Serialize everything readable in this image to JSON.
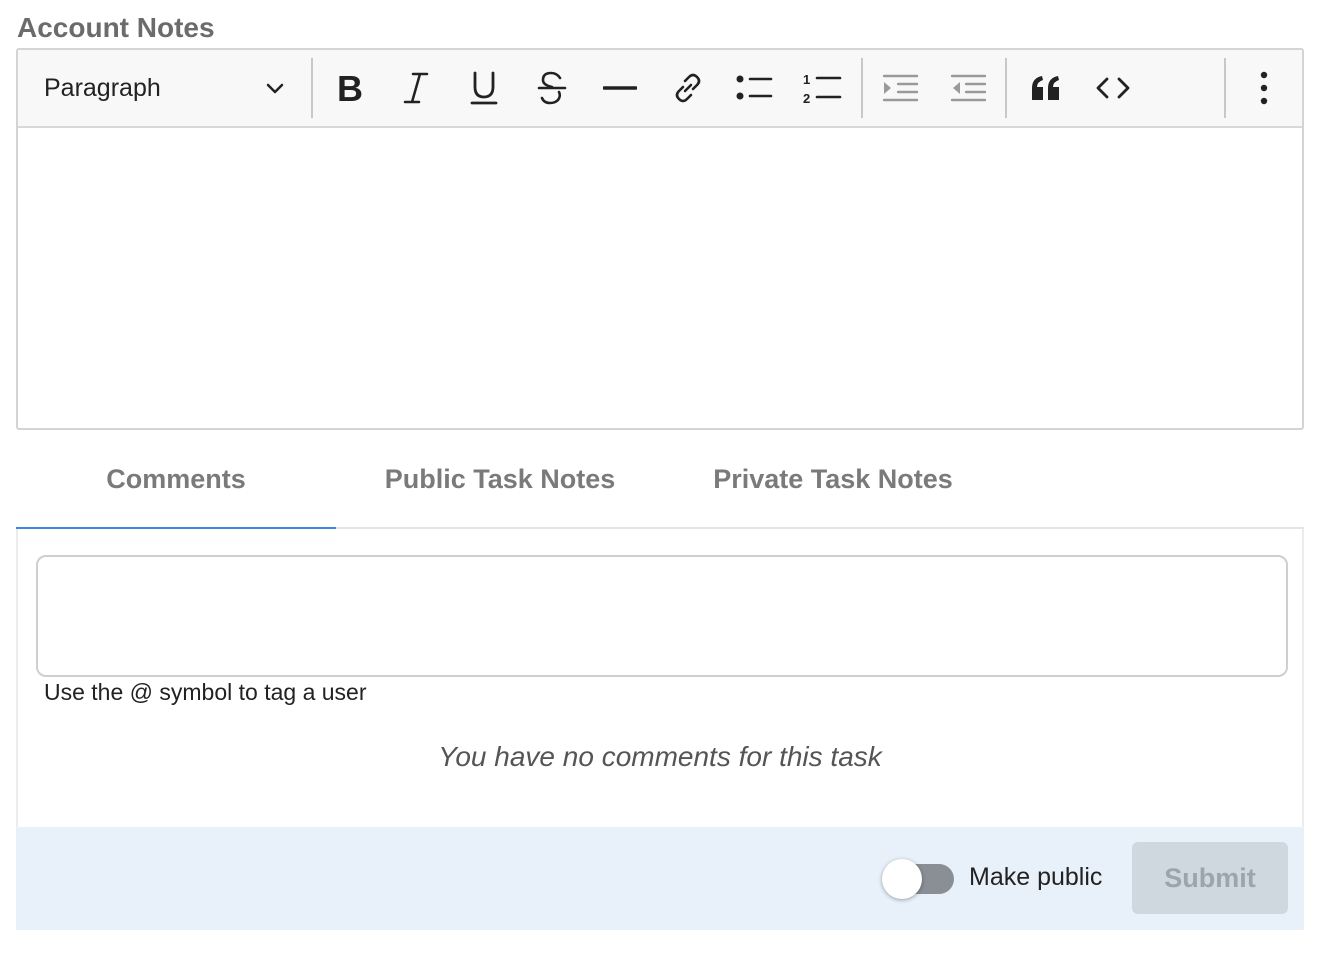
{
  "section": {
    "title": "Account Notes"
  },
  "toolbar": {
    "block_format": "Paragraph",
    "buttons": [
      {
        "id": "bold",
        "icon": "bold-icon"
      },
      {
        "id": "italic",
        "icon": "italic-icon"
      },
      {
        "id": "underline",
        "icon": "underline-icon"
      },
      {
        "id": "strikethrough",
        "icon": "strikethrough-icon"
      },
      {
        "id": "horizontal-rule",
        "icon": "horizontal-rule-icon"
      },
      {
        "id": "link",
        "icon": "link-icon"
      },
      {
        "id": "bulleted-list",
        "icon": "bulleted-list-icon"
      },
      {
        "id": "numbered-list",
        "icon": "numbered-list-icon"
      },
      {
        "id": "indent",
        "icon": "indent-icon"
      },
      {
        "id": "outdent",
        "icon": "outdent-icon"
      },
      {
        "id": "blockquote",
        "icon": "quote-icon"
      },
      {
        "id": "code",
        "icon": "code-icon"
      },
      {
        "id": "more",
        "icon": "more-vertical-icon"
      }
    ]
  },
  "tabs": [
    {
      "label": "Comments",
      "active": true
    },
    {
      "label": "Public Task Notes",
      "active": false
    },
    {
      "label": "Private Task Notes",
      "active": false
    }
  ],
  "comments": {
    "input_value": "",
    "hint": "Use the @ symbol to tag a user",
    "empty_message": "You have no comments for this task"
  },
  "footer": {
    "toggle_label": "Make public",
    "toggle_on": false,
    "submit_label": "Submit"
  },
  "colors": {
    "accent": "#3f87db",
    "footer_bg": "#e8f1fa",
    "submit_disabled_bg": "#cfd8df",
    "toggle_off": "#8a8f96"
  }
}
